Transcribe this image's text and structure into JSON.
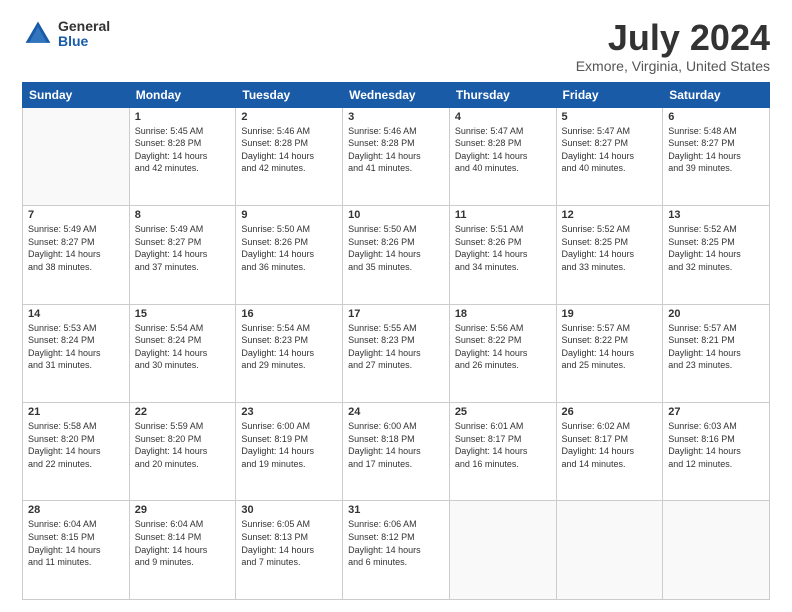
{
  "logo": {
    "general": "General",
    "blue": "Blue"
  },
  "title": "July 2024",
  "location": "Exmore, Virginia, United States",
  "days_of_week": [
    "Sunday",
    "Monday",
    "Tuesday",
    "Wednesday",
    "Thursday",
    "Friday",
    "Saturday"
  ],
  "weeks": [
    [
      {
        "day": "",
        "info": ""
      },
      {
        "day": "1",
        "info": "Sunrise: 5:45 AM\nSunset: 8:28 PM\nDaylight: 14 hours\nand 42 minutes."
      },
      {
        "day": "2",
        "info": "Sunrise: 5:46 AM\nSunset: 8:28 PM\nDaylight: 14 hours\nand 42 minutes."
      },
      {
        "day": "3",
        "info": "Sunrise: 5:46 AM\nSunset: 8:28 PM\nDaylight: 14 hours\nand 41 minutes."
      },
      {
        "day": "4",
        "info": "Sunrise: 5:47 AM\nSunset: 8:28 PM\nDaylight: 14 hours\nand 40 minutes."
      },
      {
        "day": "5",
        "info": "Sunrise: 5:47 AM\nSunset: 8:27 PM\nDaylight: 14 hours\nand 40 minutes."
      },
      {
        "day": "6",
        "info": "Sunrise: 5:48 AM\nSunset: 8:27 PM\nDaylight: 14 hours\nand 39 minutes."
      }
    ],
    [
      {
        "day": "7",
        "info": "Sunrise: 5:49 AM\nSunset: 8:27 PM\nDaylight: 14 hours\nand 38 minutes."
      },
      {
        "day": "8",
        "info": "Sunrise: 5:49 AM\nSunset: 8:27 PM\nDaylight: 14 hours\nand 37 minutes."
      },
      {
        "day": "9",
        "info": "Sunrise: 5:50 AM\nSunset: 8:26 PM\nDaylight: 14 hours\nand 36 minutes."
      },
      {
        "day": "10",
        "info": "Sunrise: 5:50 AM\nSunset: 8:26 PM\nDaylight: 14 hours\nand 35 minutes."
      },
      {
        "day": "11",
        "info": "Sunrise: 5:51 AM\nSunset: 8:26 PM\nDaylight: 14 hours\nand 34 minutes."
      },
      {
        "day": "12",
        "info": "Sunrise: 5:52 AM\nSunset: 8:25 PM\nDaylight: 14 hours\nand 33 minutes."
      },
      {
        "day": "13",
        "info": "Sunrise: 5:52 AM\nSunset: 8:25 PM\nDaylight: 14 hours\nand 32 minutes."
      }
    ],
    [
      {
        "day": "14",
        "info": "Sunrise: 5:53 AM\nSunset: 8:24 PM\nDaylight: 14 hours\nand 31 minutes."
      },
      {
        "day": "15",
        "info": "Sunrise: 5:54 AM\nSunset: 8:24 PM\nDaylight: 14 hours\nand 30 minutes."
      },
      {
        "day": "16",
        "info": "Sunrise: 5:54 AM\nSunset: 8:23 PM\nDaylight: 14 hours\nand 29 minutes."
      },
      {
        "day": "17",
        "info": "Sunrise: 5:55 AM\nSunset: 8:23 PM\nDaylight: 14 hours\nand 27 minutes."
      },
      {
        "day": "18",
        "info": "Sunrise: 5:56 AM\nSunset: 8:22 PM\nDaylight: 14 hours\nand 26 minutes."
      },
      {
        "day": "19",
        "info": "Sunrise: 5:57 AM\nSunset: 8:22 PM\nDaylight: 14 hours\nand 25 minutes."
      },
      {
        "day": "20",
        "info": "Sunrise: 5:57 AM\nSunset: 8:21 PM\nDaylight: 14 hours\nand 23 minutes."
      }
    ],
    [
      {
        "day": "21",
        "info": "Sunrise: 5:58 AM\nSunset: 8:20 PM\nDaylight: 14 hours\nand 22 minutes."
      },
      {
        "day": "22",
        "info": "Sunrise: 5:59 AM\nSunset: 8:20 PM\nDaylight: 14 hours\nand 20 minutes."
      },
      {
        "day": "23",
        "info": "Sunrise: 6:00 AM\nSunset: 8:19 PM\nDaylight: 14 hours\nand 19 minutes."
      },
      {
        "day": "24",
        "info": "Sunrise: 6:00 AM\nSunset: 8:18 PM\nDaylight: 14 hours\nand 17 minutes."
      },
      {
        "day": "25",
        "info": "Sunrise: 6:01 AM\nSunset: 8:17 PM\nDaylight: 14 hours\nand 16 minutes."
      },
      {
        "day": "26",
        "info": "Sunrise: 6:02 AM\nSunset: 8:17 PM\nDaylight: 14 hours\nand 14 minutes."
      },
      {
        "day": "27",
        "info": "Sunrise: 6:03 AM\nSunset: 8:16 PM\nDaylight: 14 hours\nand 12 minutes."
      }
    ],
    [
      {
        "day": "28",
        "info": "Sunrise: 6:04 AM\nSunset: 8:15 PM\nDaylight: 14 hours\nand 11 minutes."
      },
      {
        "day": "29",
        "info": "Sunrise: 6:04 AM\nSunset: 8:14 PM\nDaylight: 14 hours\nand 9 minutes."
      },
      {
        "day": "30",
        "info": "Sunrise: 6:05 AM\nSunset: 8:13 PM\nDaylight: 14 hours\nand 7 minutes."
      },
      {
        "day": "31",
        "info": "Sunrise: 6:06 AM\nSunset: 8:12 PM\nDaylight: 14 hours\nand 6 minutes."
      },
      {
        "day": "",
        "info": ""
      },
      {
        "day": "",
        "info": ""
      },
      {
        "day": "",
        "info": ""
      }
    ]
  ]
}
